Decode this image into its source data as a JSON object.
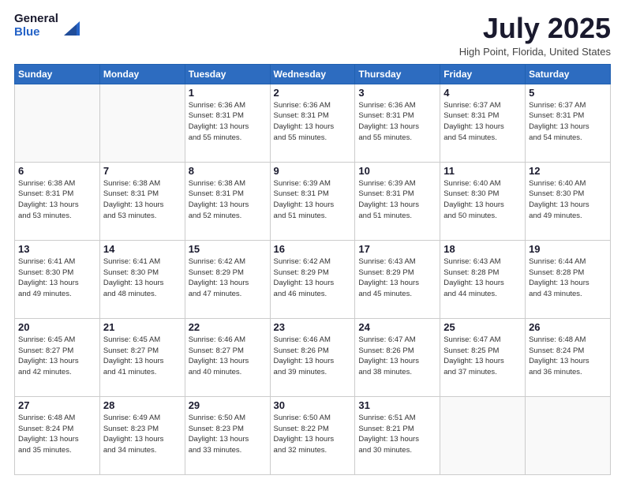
{
  "logo": {
    "text_general": "General",
    "text_blue": "Blue"
  },
  "title": {
    "month_year": "July 2025",
    "location": "High Point, Florida, United States"
  },
  "weekdays": [
    "Sunday",
    "Monday",
    "Tuesday",
    "Wednesday",
    "Thursday",
    "Friday",
    "Saturday"
  ],
  "weeks": [
    [
      {
        "day": "",
        "info": ""
      },
      {
        "day": "",
        "info": ""
      },
      {
        "day": "1",
        "info": "Sunrise: 6:36 AM\nSunset: 8:31 PM\nDaylight: 13 hours\nand 55 minutes."
      },
      {
        "day": "2",
        "info": "Sunrise: 6:36 AM\nSunset: 8:31 PM\nDaylight: 13 hours\nand 55 minutes."
      },
      {
        "day": "3",
        "info": "Sunrise: 6:36 AM\nSunset: 8:31 PM\nDaylight: 13 hours\nand 55 minutes."
      },
      {
        "day": "4",
        "info": "Sunrise: 6:37 AM\nSunset: 8:31 PM\nDaylight: 13 hours\nand 54 minutes."
      },
      {
        "day": "5",
        "info": "Sunrise: 6:37 AM\nSunset: 8:31 PM\nDaylight: 13 hours\nand 54 minutes."
      }
    ],
    [
      {
        "day": "6",
        "info": "Sunrise: 6:38 AM\nSunset: 8:31 PM\nDaylight: 13 hours\nand 53 minutes."
      },
      {
        "day": "7",
        "info": "Sunrise: 6:38 AM\nSunset: 8:31 PM\nDaylight: 13 hours\nand 53 minutes."
      },
      {
        "day": "8",
        "info": "Sunrise: 6:38 AM\nSunset: 8:31 PM\nDaylight: 13 hours\nand 52 minutes."
      },
      {
        "day": "9",
        "info": "Sunrise: 6:39 AM\nSunset: 8:31 PM\nDaylight: 13 hours\nand 51 minutes."
      },
      {
        "day": "10",
        "info": "Sunrise: 6:39 AM\nSunset: 8:31 PM\nDaylight: 13 hours\nand 51 minutes."
      },
      {
        "day": "11",
        "info": "Sunrise: 6:40 AM\nSunset: 8:30 PM\nDaylight: 13 hours\nand 50 minutes."
      },
      {
        "day": "12",
        "info": "Sunrise: 6:40 AM\nSunset: 8:30 PM\nDaylight: 13 hours\nand 49 minutes."
      }
    ],
    [
      {
        "day": "13",
        "info": "Sunrise: 6:41 AM\nSunset: 8:30 PM\nDaylight: 13 hours\nand 49 minutes."
      },
      {
        "day": "14",
        "info": "Sunrise: 6:41 AM\nSunset: 8:30 PM\nDaylight: 13 hours\nand 48 minutes."
      },
      {
        "day": "15",
        "info": "Sunrise: 6:42 AM\nSunset: 8:29 PM\nDaylight: 13 hours\nand 47 minutes."
      },
      {
        "day": "16",
        "info": "Sunrise: 6:42 AM\nSunset: 8:29 PM\nDaylight: 13 hours\nand 46 minutes."
      },
      {
        "day": "17",
        "info": "Sunrise: 6:43 AM\nSunset: 8:29 PM\nDaylight: 13 hours\nand 45 minutes."
      },
      {
        "day": "18",
        "info": "Sunrise: 6:43 AM\nSunset: 8:28 PM\nDaylight: 13 hours\nand 44 minutes."
      },
      {
        "day": "19",
        "info": "Sunrise: 6:44 AM\nSunset: 8:28 PM\nDaylight: 13 hours\nand 43 minutes."
      }
    ],
    [
      {
        "day": "20",
        "info": "Sunrise: 6:45 AM\nSunset: 8:27 PM\nDaylight: 13 hours\nand 42 minutes."
      },
      {
        "day": "21",
        "info": "Sunrise: 6:45 AM\nSunset: 8:27 PM\nDaylight: 13 hours\nand 41 minutes."
      },
      {
        "day": "22",
        "info": "Sunrise: 6:46 AM\nSunset: 8:27 PM\nDaylight: 13 hours\nand 40 minutes."
      },
      {
        "day": "23",
        "info": "Sunrise: 6:46 AM\nSunset: 8:26 PM\nDaylight: 13 hours\nand 39 minutes."
      },
      {
        "day": "24",
        "info": "Sunrise: 6:47 AM\nSunset: 8:26 PM\nDaylight: 13 hours\nand 38 minutes."
      },
      {
        "day": "25",
        "info": "Sunrise: 6:47 AM\nSunset: 8:25 PM\nDaylight: 13 hours\nand 37 minutes."
      },
      {
        "day": "26",
        "info": "Sunrise: 6:48 AM\nSunset: 8:24 PM\nDaylight: 13 hours\nand 36 minutes."
      }
    ],
    [
      {
        "day": "27",
        "info": "Sunrise: 6:48 AM\nSunset: 8:24 PM\nDaylight: 13 hours\nand 35 minutes."
      },
      {
        "day": "28",
        "info": "Sunrise: 6:49 AM\nSunset: 8:23 PM\nDaylight: 13 hours\nand 34 minutes."
      },
      {
        "day": "29",
        "info": "Sunrise: 6:50 AM\nSunset: 8:23 PM\nDaylight: 13 hours\nand 33 minutes."
      },
      {
        "day": "30",
        "info": "Sunrise: 6:50 AM\nSunset: 8:22 PM\nDaylight: 13 hours\nand 32 minutes."
      },
      {
        "day": "31",
        "info": "Sunrise: 6:51 AM\nSunset: 8:21 PM\nDaylight: 13 hours\nand 30 minutes."
      },
      {
        "day": "",
        "info": ""
      },
      {
        "day": "",
        "info": ""
      }
    ]
  ]
}
